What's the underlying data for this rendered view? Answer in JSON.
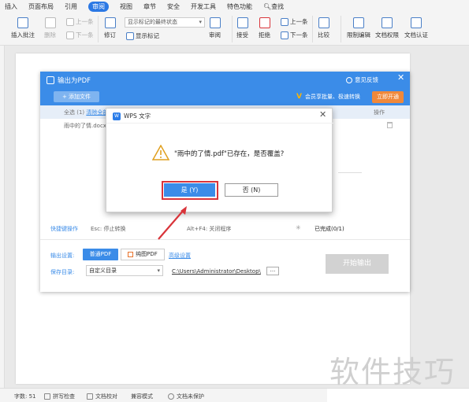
{
  "menu": {
    "items": [
      "插入",
      "页面布局",
      "引用",
      "审阅",
      "视图",
      "章节",
      "安全",
      "开发工具",
      "特色功能",
      "查找"
    ],
    "active_index": 3
  },
  "ribbon": {
    "insert_comment": "插入批注",
    "delete": "删除",
    "prev_top": "上一条",
    "next_top": "下一条",
    "revise": "修订",
    "show_markup_dropdown": "显示标记的最终状态",
    "show_markup": "显示标记",
    "review": "审阅",
    "accept": "接受",
    "reject": "拒绝",
    "prev": "上一条",
    "next": "下一条",
    "compare": "比较",
    "restrict_edit": "限制编辑",
    "doc_permission": "文档权限",
    "doc_auth": "文档认证"
  },
  "pdf_dialog": {
    "title": "输出为PDF",
    "feedback": "意见反馈",
    "add_file": "添加文件",
    "promo": "会员享批量、极速转换",
    "open_now": "立即开通",
    "select_all": "全选 (1)",
    "clear_all": "清除全部",
    "operation": "操作",
    "file_name": "雨中的了情.docx",
    "shortcut_label": "快捷键操作",
    "shortcut_esc": "Esc: 停止转换",
    "shortcut_alt": "Alt+F4: 关闭程序",
    "completed": "已完成(0/1)",
    "output_settings": "输出设置:",
    "normal_pdf": "普通PDF",
    "image_pdf": "纯图PDF",
    "advanced": "高级设置",
    "save_dir": "保存目录:",
    "custom_dir": "自定义目录",
    "path": "C:\\Users\\Administrator\\Desktop\\",
    "browse": "...",
    "start": "开始输出"
  },
  "confirm_dialog": {
    "title": "WPS 文字",
    "message": "\"雨中的了情.pdf\"已存在，是否覆盖?",
    "yes": "是 (Y)",
    "no": "否 (N)"
  },
  "status": {
    "word_count": "字数: 51",
    "spell_check": "拼写检查",
    "doc_proof": "文档校对",
    "compat_mode": "兼容模式",
    "doc_unprotected": "文档未保护"
  },
  "watermark": "软件技巧",
  "colors": {
    "accent": "#3b8ce8",
    "highlight_outline": "#d9343a",
    "promo_button": "#f0883a"
  }
}
